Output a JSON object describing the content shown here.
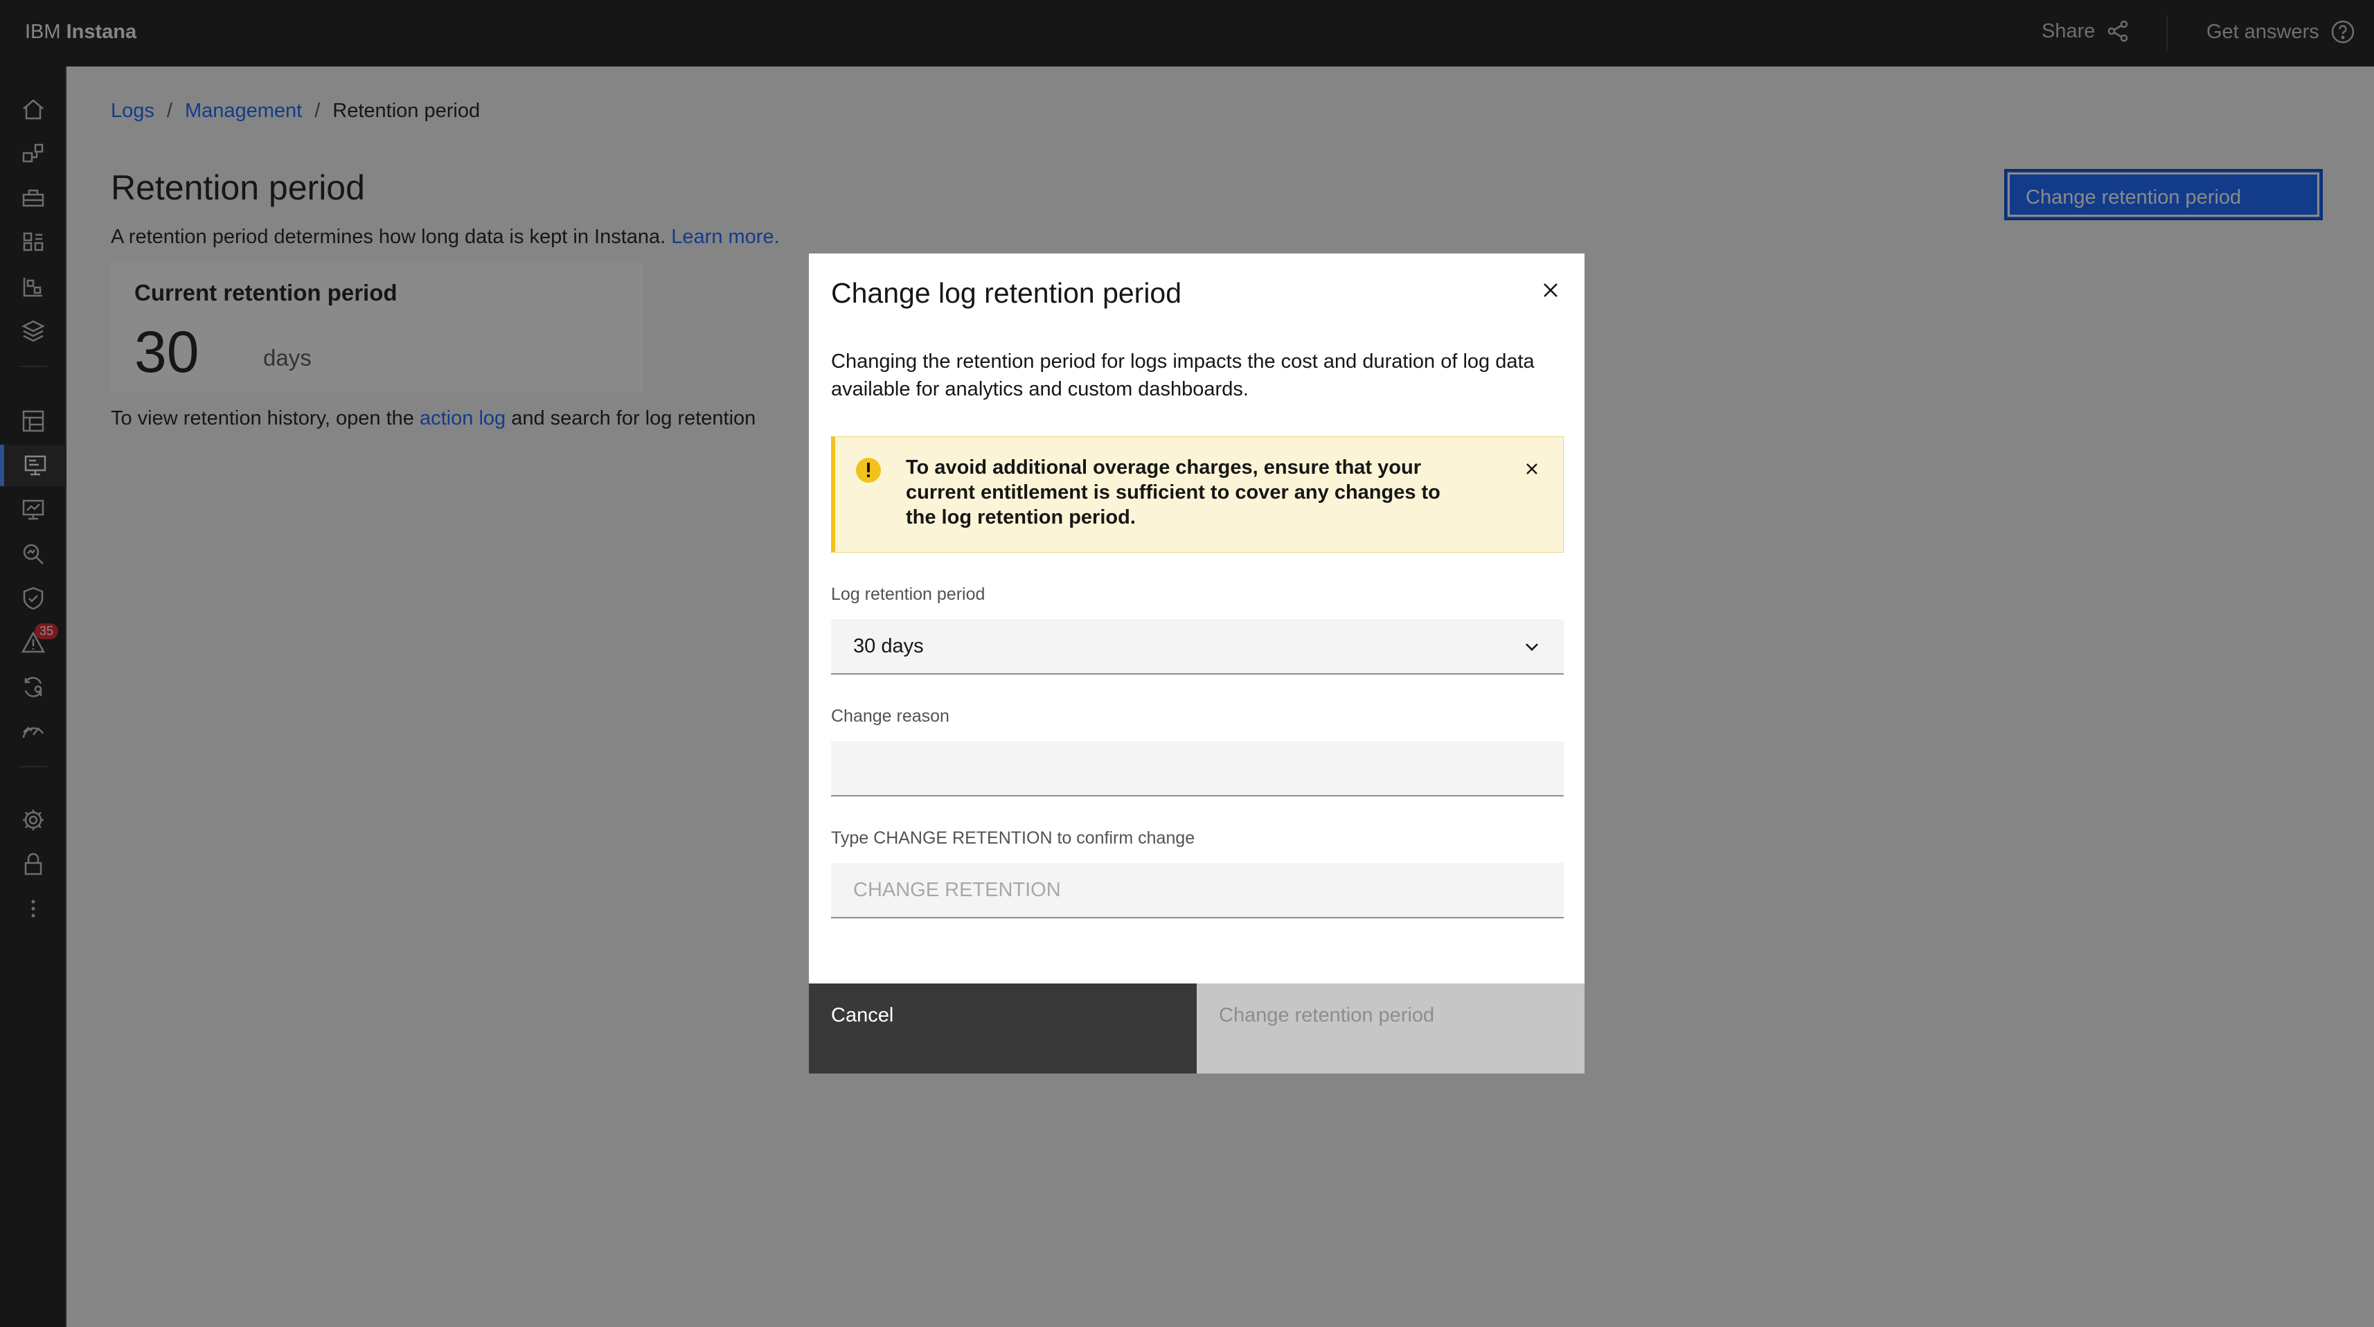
{
  "header": {
    "brand_prefix": "IBM",
    "brand_name": "Instana",
    "share_label": "Share",
    "answers_label": "Get answers"
  },
  "sidenav": {
    "icons": [
      "home-icon",
      "application-map-icon",
      "infrastructure-icon",
      "platforms-icon",
      "synthetic-icon",
      "stack-icon",
      "dashboards-icon",
      "logs-icon",
      "analytics-icon",
      "explore-icon",
      "security-icon",
      "events-icon",
      "automation-icon",
      "performance-icon",
      "settings-icon",
      "lock-icon",
      "more-icon"
    ],
    "events_badge": "35"
  },
  "breadcrumb": {
    "items": [
      "Logs",
      "Management",
      "Retention period"
    ],
    "separator": "/"
  },
  "page": {
    "title": "Retention period",
    "description": "A retention period determines how long data is kept in Instana.",
    "learn_more": "Learn more.",
    "primary_button": "Change retention period"
  },
  "card": {
    "title": "Current retention period",
    "value": "30",
    "unit": "days"
  },
  "history": {
    "prefix": "To view retention history, open the",
    "link": "action log",
    "suffix": "and search for log retention"
  },
  "modal": {
    "title": "Change log retention period",
    "description": "Changing the retention period for logs impacts the cost and duration of log data available for analytics and custom dashboards.",
    "notice": "To avoid additional overage charges, ensure that your current entitlement is sufficient to cover any changes to the log retention period.",
    "retention_label": "Log retention period",
    "retention_value": "30 days",
    "reason_label": "Change reason",
    "reason_value": "",
    "confirm_label": "Type CHANGE RETENTION to confirm change",
    "confirm_placeholder": "CHANGE RETENTION",
    "cancel_button": "Cancel",
    "submit_button": "Change retention period"
  },
  "colors": {
    "accent": "#0f62fe",
    "warning": "#f1c21b",
    "header_bg": "#161616"
  }
}
